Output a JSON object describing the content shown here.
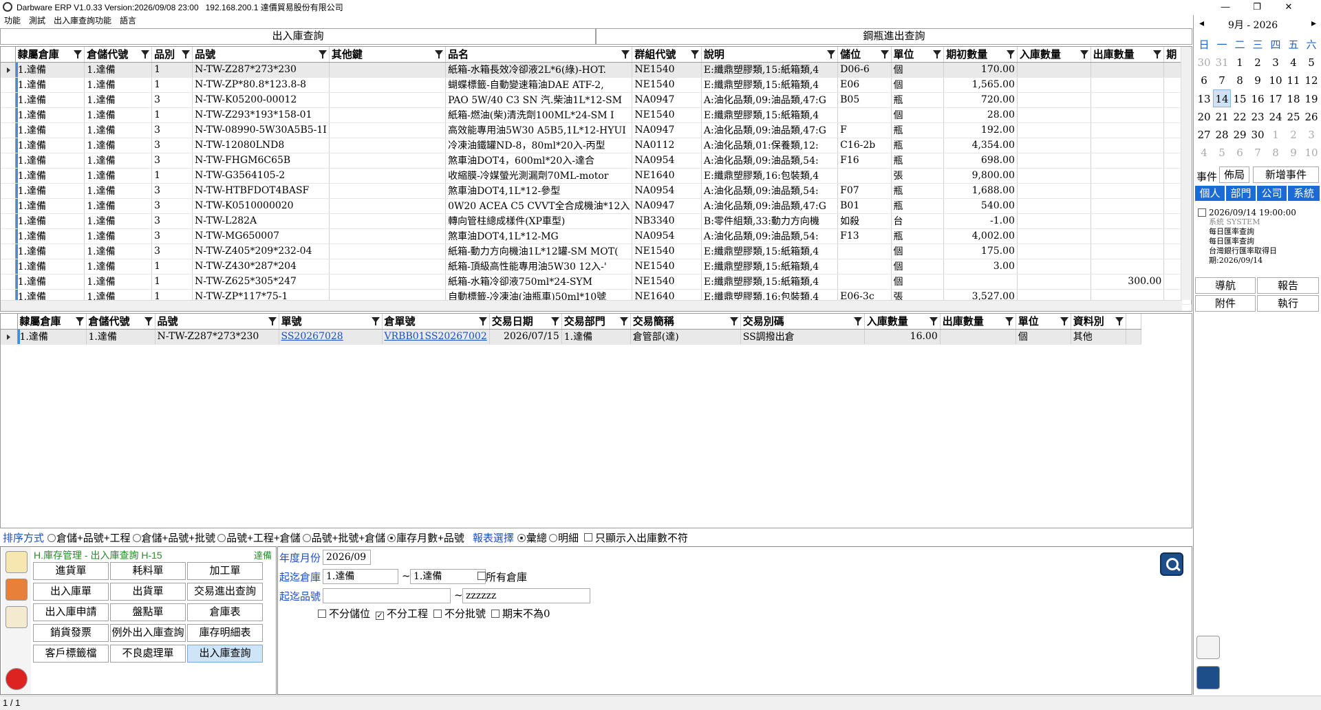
{
  "window": {
    "title": "Darbware ERP V1.0.33 Version:2026/09/08 23:00   192.168.200.1 達價貿易股份有限公司",
    "menu": [
      "功能",
      "測試",
      "出入庫查詢功能",
      "語言"
    ]
  },
  "tabs": [
    "出入庫查詢",
    "鋼瓶進出查詢"
  ],
  "grid_top": {
    "columns": [
      "隸屬倉庫",
      "倉儲代號",
      "品別",
      "品號",
      "其他鍵",
      "品名",
      "群組代號",
      "說明",
      "儲位",
      "單位",
      "期初數量",
      "入庫數量",
      "出庫數量",
      "期"
    ],
    "rows": [
      [
        "1.達備",
        "1.達備",
        "1",
        "N-TW-Z287*273*230",
        "",
        "紙箱-水箱長效冷卻液2L*6(綠)-HOT.",
        "NE1540",
        "E:纖鼎塑膠類,15:紙箱類,4",
        "D06-6",
        "個",
        "170.00",
        "",
        "",
        ""
      ],
      [
        "1.達備",
        "1.達備",
        "1",
        "N-TW-ZP*80.8*123.8-8",
        "",
        "蝴蝶標籤-自動變速箱油DAE ATF-2,",
        "NE1540",
        "E:纖鼎塑膠類,15:紙箱類,4",
        "E06",
        "個",
        "1,565.00",
        "",
        "",
        ""
      ],
      [
        "1.達備",
        "1.達備",
        "3",
        "N-TW-K05200-00012",
        "",
        "PAO 5W/40 C3 SN 汽.柴油1L*12-SM",
        "NA0947",
        "A:油化品類,09:油品類,47:G",
        "B05",
        "瓶",
        "720.00",
        "",
        "",
        ""
      ],
      [
        "1.達備",
        "1.達備",
        "1",
        "N-TW-Z293*193*158-01",
        "",
        "紙箱-燃油(柴)清洗劑100ML*24-SM I",
        "NE1540",
        "E:纖鼎塑膠類,15:紙箱類,4",
        "",
        "個",
        "28.00",
        "",
        "",
        ""
      ],
      [
        "1.達備",
        "1.達備",
        "3",
        "N-TW-08990-5W30A5B5-1I",
        "",
        "高效能專用油5W30 A5B5,1L*12-HYUI",
        "NA0947",
        "A:油化品類,09:油品類,47:G",
        "F",
        "瓶",
        "192.00",
        "",
        "",
        ""
      ],
      [
        "1.達備",
        "1.達備",
        "3",
        "N-TW-12080LND8",
        "",
        "冷凍油鐵罐ND-8，80ml*20入-丙型",
        "NA0112",
        "A:油化品類,01:保養類,12:",
        "C16-2b",
        "瓶",
        "4,354.00",
        "",
        "",
        ""
      ],
      [
        "1.達備",
        "1.達備",
        "3",
        "N-TW-FHGM6C65B",
        "",
        "煞車油DOT4，600ml*20入-達合",
        "NA0954",
        "A:油化品類,09:油品類,54:",
        "F16",
        "瓶",
        "698.00",
        "",
        "",
        ""
      ],
      [
        "1.達備",
        "1.達備",
        "1",
        "N-TW-G3564105-2",
        "",
        "收縮膜-冷媒螢光測漏劑70ML-motor",
        "NE1640",
        "E:纖鼎塑膠類,16:包裝類,4",
        "",
        "張",
        "9,800.00",
        "",
        "",
        ""
      ],
      [
        "1.達備",
        "1.達備",
        "3",
        "N-TW-HTBFDOT4BASF",
        "",
        "煞車油DOT4,1L*12-參型",
        "NA0954",
        "A:油化品類,09:油品類,54:",
        "F07",
        "瓶",
        "1,688.00",
        "",
        "",
        ""
      ],
      [
        "1.達備",
        "1.達備",
        "3",
        "N-TW-K0510000020",
        "",
        "0W20 ACEA C5 CVVT全合成機油*12入",
        "NA0947",
        "A:油化品類,09:油品類,47:G",
        "B01",
        "瓶",
        "540.00",
        "",
        "",
        ""
      ],
      [
        "1.達備",
        "1.達備",
        "3",
        "N-TW-L282A",
        "",
        "轉向管柱總成樣件(XP車型)",
        "NB3340",
        "B:零件組類,33:動力方向機",
        "如殺",
        "台",
        "-1.00",
        "",
        "",
        ""
      ],
      [
        "1.達備",
        "1.達備",
        "3",
        "N-TW-MG650007",
        "",
        "煞車油DOT4,1L*12-MG",
        "NA0954",
        "A:油化品類,09:油品類,54:",
        "F13",
        "瓶",
        "4,002.00",
        "",
        "",
        ""
      ],
      [
        "1.達備",
        "1.達備",
        "3",
        "N-TW-Z405*209*232-04",
        "",
        "紙箱-動力方向機油1L*12罐-SM MOT(",
        "NE1540",
        "E:纖鼎塑膠類,15:紙箱類,4",
        "",
        "個",
        "175.00",
        "",
        "",
        ""
      ],
      [
        "1.達備",
        "1.達備",
        "1",
        "N-TW-Z430*287*204",
        "",
        "紙箱-頂級高性能專用油5W30 12入-'",
        "NE1540",
        "E:纖鼎塑膠類,15:紙箱類,4",
        "",
        "個",
        "3.00",
        "",
        "",
        ""
      ],
      [
        "1.達備",
        "1.達備",
        "1",
        "N-TW-Z625*305*247",
        "",
        "紙箱-水箱冷卻液750ml*24-SYM",
        "NE1540",
        "E:纖鼎塑膠類,15:紙箱類,4",
        "",
        "個",
        "",
        "",
        "300.00",
        ""
      ],
      [
        "1.達備",
        "1.達備",
        "1",
        "N-TW-ZP*117*75-1",
        "",
        "自動標籤-冷凍油(油瓶車)50ml*10號",
        "NE1640",
        "E:纖鼎塑膠類,16:包裝類,4",
        "E06-3c",
        "張",
        "3,527.00",
        "",
        "",
        ""
      ]
    ]
  },
  "grid_bottom": {
    "columns": [
      "隸屬倉庫",
      "倉儲代號",
      "品號",
      "單號",
      "倉單號",
      "交易日期",
      "交易部門",
      "交易簡稱",
      "交易別碼",
      "入庫數量",
      "出庫數量",
      "單位",
      "資料別"
    ],
    "rows": [
      [
        "1.達備",
        "1.達備",
        "N-TW-Z287*273*230",
        "SS20267028",
        "VRBB01SS20267002",
        "2026/07/15",
        "1.達備",
        "倉管部(達)",
        "SS調撥出倉",
        "16.00",
        "",
        "個",
        "其他"
      ]
    ]
  },
  "options": {
    "sort_label": "排序方式",
    "sort_options": [
      "倉儲+品號+工程",
      "倉儲+品號+批號",
      "品號+工程+倉儲",
      "品號+批號+倉儲",
      "庫存月數+品號"
    ],
    "sort_selected": 4,
    "report_label": "報表選擇",
    "report_options": [
      "彙總",
      "明細"
    ],
    "report_selected": 0,
    "only_mismatch_label": "只顯示入出庫數不符"
  },
  "module": {
    "title": "H.庫存管理 - 出入庫查詢  H-15",
    "tag": "達備",
    "buttons": [
      "進貨單",
      "耗料單",
      "加工單",
      "出入庫單",
      "出貨單",
      "交易進出查詢",
      "出入庫申請",
      "盤點單",
      "倉庫表",
      "銷貨發票",
      "例外出入庫查詢",
      "庫存明細表",
      "客戶標籤檔",
      "不良處理單",
      "出入庫查詢"
    ],
    "active_button": 14
  },
  "criteria": {
    "year_month_label": "年度月份",
    "year_month_value": "2026/09",
    "warehouse_label": "起迄倉庫",
    "warehouse_from": "1.達備",
    "warehouse_to": "1.達備",
    "all_warehouse_label": "所有倉庫",
    "item_label": "起迄品號",
    "item_from": "",
    "item_to": "zzzzzz",
    "checks": [
      {
        "label": "不分儲位",
        "checked": false
      },
      {
        "label": "不分工程",
        "checked": true
      },
      {
        "label": "不分批號",
        "checked": false
      },
      {
        "label": "期末不為0",
        "checked": false
      }
    ]
  },
  "status": {
    "page": "1 / 1"
  },
  "calendar": {
    "month_label": "9月 - 2026",
    "weekdays": [
      "日",
      "一",
      "二",
      "三",
      "四",
      "五",
      "六"
    ],
    "days": [
      [
        "30",
        "31",
        "1",
        "2",
        "3",
        "4",
        "5"
      ],
      [
        "6",
        "7",
        "8",
        "9",
        "10",
        "11",
        "12"
      ],
      [
        "13",
        "14",
        "15",
        "16",
        "17",
        "18",
        "19"
      ],
      [
        "20",
        "21",
        "22",
        "23",
        "24",
        "25",
        "26"
      ],
      [
        "27",
        "28",
        "29",
        "30",
        "1",
        "2",
        "3"
      ],
      [
        "4",
        "5",
        "6",
        "7",
        "8",
        "9",
        "10"
      ]
    ],
    "today": "14",
    "event_label": "事件",
    "layout_btn": "佈局",
    "new_event_btn": "新增事件",
    "scope_tabs": [
      "個人",
      "部門",
      "公司",
      "系統"
    ],
    "event": {
      "time": "2026/09/14 19:00:00",
      "source": "系統 SYSTEM",
      "line1": "每日匯率查詢",
      "line2": "每日匯率查詢",
      "line3": "台灣銀行匯率取得日",
      "line4": "期:2026/09/14"
    },
    "actions": [
      "導航",
      "報告",
      "附件",
      "執行"
    ]
  },
  "colors": {
    "accent": "#1b6bd6",
    "link": "#1a4fc4",
    "module_green": "#2a8a2a"
  }
}
